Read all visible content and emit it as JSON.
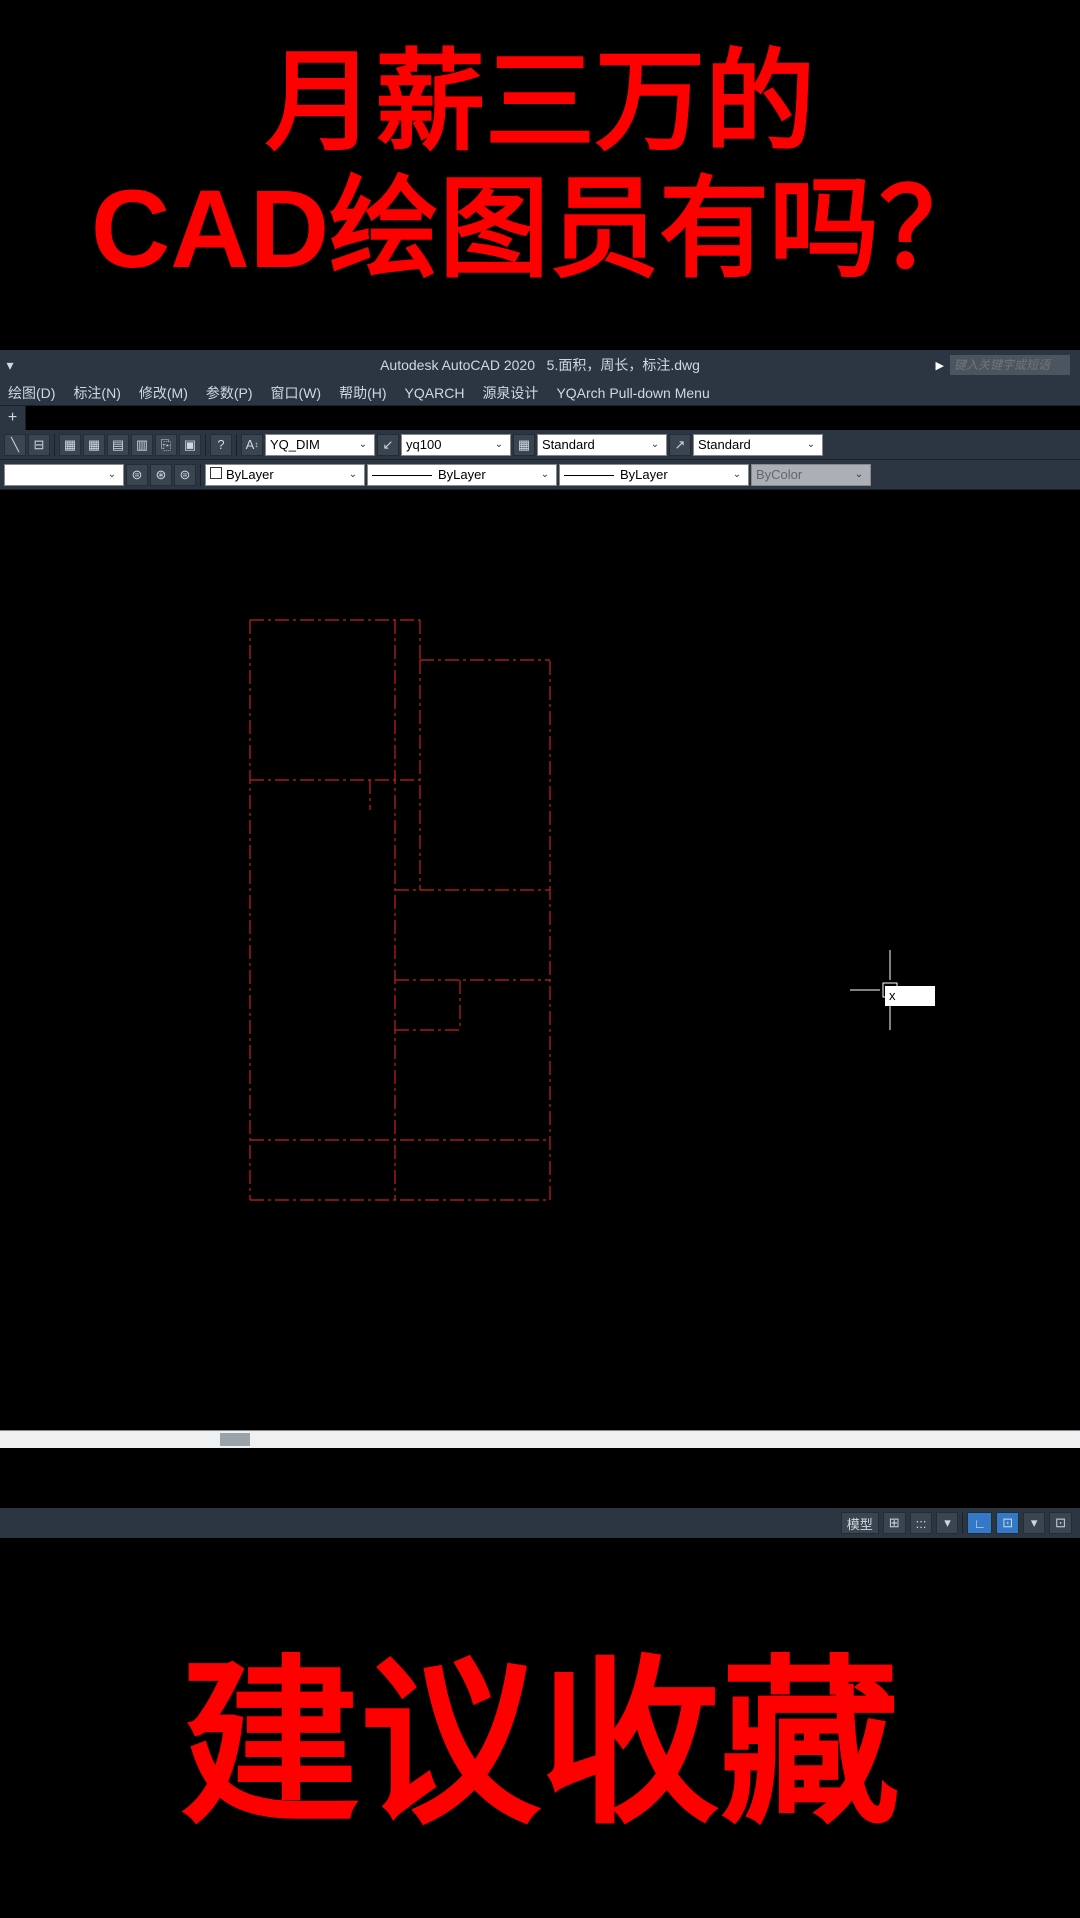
{
  "overlay": {
    "top_line1": "月薪三万的",
    "top_line2": "CAD绘图员有吗？",
    "bottom": "建议收藏"
  },
  "title": {
    "app": "Autodesk AutoCAD 2020",
    "file": "5.面积，周长，标注.dwg",
    "search_placeholder": "键入关键字或短语"
  },
  "menu": {
    "items": [
      "绘图(D)",
      "标注(N)",
      "修改(M)",
      "参数(P)",
      "窗口(W)",
      "帮助(H)",
      "YQARCH",
      "源泉设计",
      "YQArch Pull-down Menu"
    ]
  },
  "toolbar1": {
    "dimstyle": "YQ_DIM",
    "scale": "yq100",
    "textstyle1": "Standard",
    "textstyle2": "Standard"
  },
  "toolbar2": {
    "layer_color": "ByLayer",
    "linetype": "ByLayer",
    "lineweight": "ByLayer",
    "plotstyle": "ByColor"
  },
  "canvas": {
    "dyn_input": "x"
  },
  "status": {
    "model": "模型",
    "buttons": [
      "⊞",
      ":::",
      "▾",
      "∟",
      "⊡",
      "▾",
      "⊡"
    ]
  }
}
